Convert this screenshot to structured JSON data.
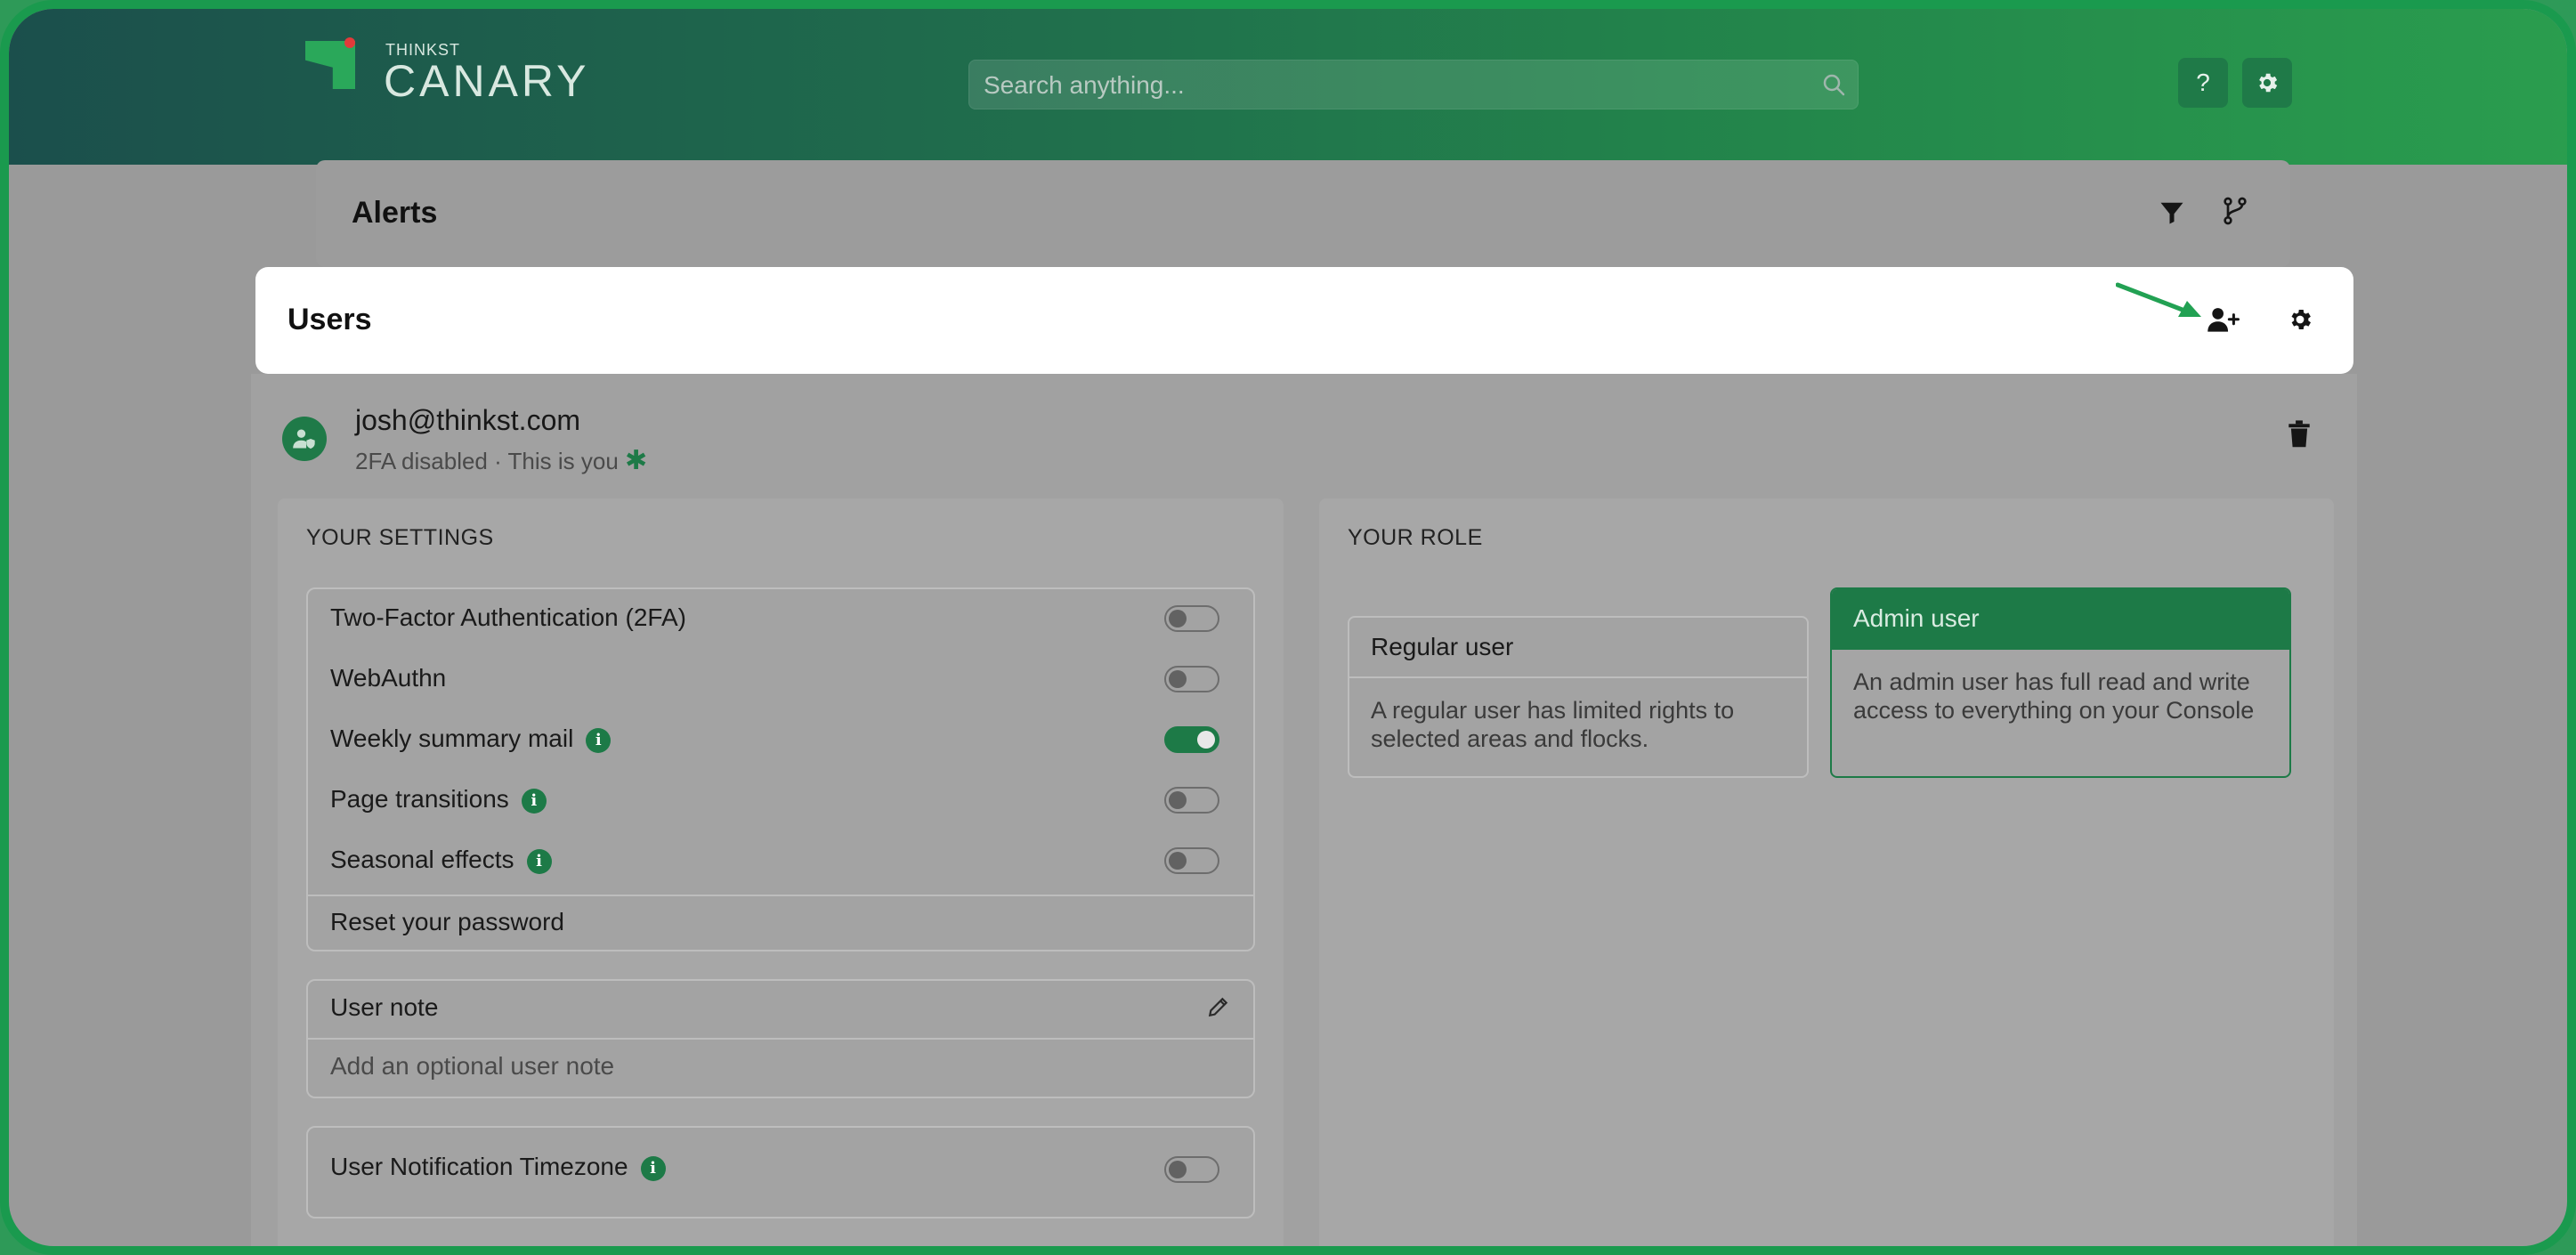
{
  "logo": {
    "small_text": "THINKST",
    "big_text": "CANARY"
  },
  "search": {
    "placeholder": "Search anything..."
  },
  "header_buttons": {
    "help_label": "?"
  },
  "alerts": {
    "title": "Alerts"
  },
  "users": {
    "title": "Users"
  },
  "user": {
    "email": "josh@thinkst.com",
    "status": "2FA disabled · This is you",
    "star": "✱"
  },
  "settings": {
    "section_label": "YOUR SETTINGS",
    "rows": [
      {
        "label": "Two-Factor Authentication (2FA)",
        "enabled": false
      },
      {
        "label": "WebAuthn",
        "enabled": false
      },
      {
        "label": "Weekly summary mail",
        "enabled": true
      },
      {
        "label": "Page transitions",
        "enabled": false
      },
      {
        "label": "Seasonal effects",
        "enabled": false
      }
    ],
    "reset_password": "Reset your password",
    "info_glyph": "i"
  },
  "note": {
    "title": "User note",
    "placeholder": "Add an optional user note"
  },
  "timezone": {
    "label": "User Notification Timezone",
    "enabled": false
  },
  "role": {
    "section_label": "YOUR ROLE",
    "regular": {
      "title": "Regular user",
      "description": "A regular user has limited rights to selected areas and flocks."
    },
    "admin": {
      "title": "Admin user",
      "description": "An admin user has full read and write access to everything on your Console"
    }
  },
  "colors": {
    "accent": "#1d7a47",
    "annotation_arrow": "#22a153"
  }
}
